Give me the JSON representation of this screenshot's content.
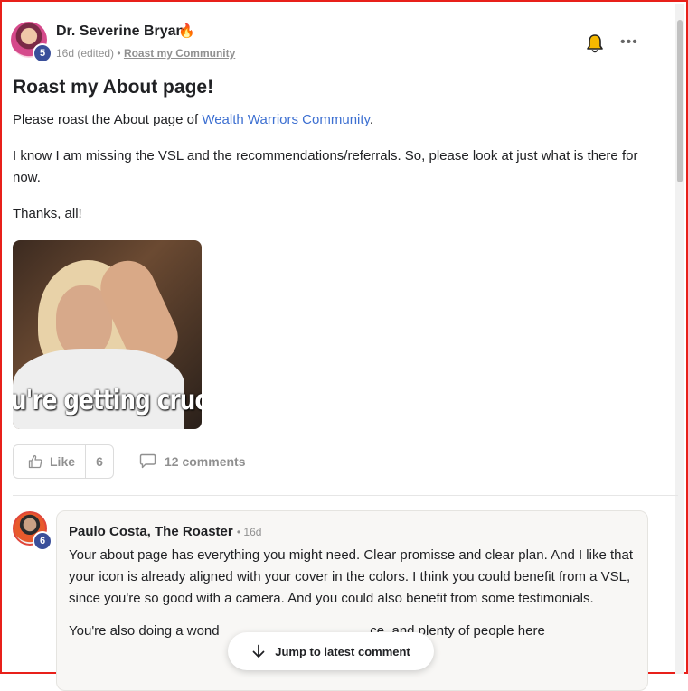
{
  "post": {
    "author": "Dr. Severine Bryan",
    "author_level": "5",
    "fire_emoji": "🔥",
    "time": "16d (edited)",
    "separator": "•",
    "category": "Roast my Community",
    "title": "Roast my About page!",
    "p1_prefix": "Please roast the About page of ",
    "p1_link": "Wealth Warriors Community",
    "p1_suffix": ".",
    "p2": "I know I am missing the VSL and the recommendations/referrals. So, please look at just what is there for now.",
    "p3": "Thanks, all!",
    "gif_caption": "u're getting crucif"
  },
  "actions": {
    "like_label": "Like",
    "like_count": "6",
    "comments_label": "12 comments"
  },
  "comment": {
    "author": "Paulo Costa, The Roaster",
    "author_level": "6",
    "time": "• 16d",
    "body": "Your about page has everything you might need. Clear promisse and clear plan. And I like that your icon is already aligned with your cover in the colors. I think you could benefit from a VSL, since you're so good with a camera. And you could also benefit from some testimonials.",
    "body2": "You're also doing a wond                                        ce, and plenty of people here"
  },
  "jump": {
    "label": "Jump to latest comment"
  },
  "icons": {
    "bell": "bell-icon",
    "more": "more-icon",
    "like": "thumbs-up-icon",
    "comment": "comment-bubble-icon",
    "arrow": "arrow-down-icon"
  },
  "colors": {
    "link": "#3c6fd1",
    "level_badge": "#3a4f9a",
    "bell": "#e0a800",
    "frame": "#e8201a"
  }
}
